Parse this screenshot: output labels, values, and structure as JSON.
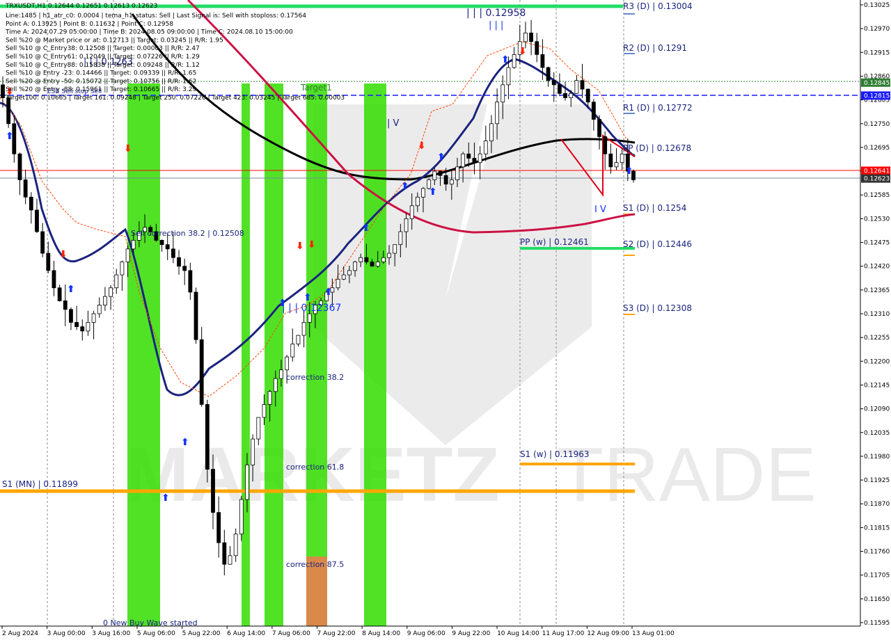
{
  "chart_data": {
    "type": "candlestick",
    "symbol_line": "TRXUSDT,H1  0.12644 0.12651 0.12613 0.12623",
    "info_lines": [
      "Line:1485 | h1_atr_c0: 0.0004 | tema_h1_status: Sell | Last Signal is: Sell with stoploss: 0.17564",
      "Point A: 0.13925 | Point B: 0.11632 | Point C: 0.12958",
      "Time A: 2024.07.29 05:00:00 | Time B: 2024.08.05 09:00:00 | Time C: 2024.08.10 15:00:00",
      "Sell %20 @ Market price or at: 0.12713 || Target: 0.03245 || R/R: 1.95",
      "Sell %10 @ C_Entry38: 0.12508 || Target: 0.00003 || R/R: 2.47",
      "Sell %10 @ C_Entry61: 0.12049 || Target: 0.07226 || R/R: 1.29",
      "Sell %10 @ C_Entry88: 0.15838 || Target: 0.09248 || R/R: 1.12",
      "Sell %10 @ Entry -23: 0.14466 || Target: 0.09339 || R/R: 1.65",
      "Sell %20 @ Entry -50: 0.15072 || Target: 0.10756 || R/R: 1.62",
      "Sell %20 @ Entry -88: 0.15961 || Target: 0.10665 || R/R: 3.29",
      "Target100: 0.10665 | Target 161: 0.09248 | Target 250: 0.07226 | Target 423: 0.03245 | Target 685: 0.00003"
    ],
    "overlap_text": "ESB Sell stop Sell",
    "price_axis": {
      "min": 0.11595,
      "max": 0.13025,
      "ticks": [
        "0.13025",
        "0.12970",
        "0.12915",
        "0.12860",
        "0.12805",
        "0.12750",
        "0.12695",
        "0.12640",
        "0.12585",
        "0.12530",
        "0.12475",
        "0.12420",
        "0.12365",
        "0.12310",
        "0.12255",
        "0.12200",
        "0.12145",
        "0.12090",
        "0.12035",
        "0.11980",
        "0.11925",
        "0.11870",
        "0.11815",
        "0.11760",
        "0.11705",
        "0.11650",
        "0.11595"
      ]
    },
    "time_axis": [
      "2 Aug 2024",
      "3 Aug 00:00",
      "3 Aug 16:00",
      "5 Aug 06:00",
      "5 Aug 22:00",
      "6 Aug 14:00",
      "7 Aug 06:00",
      "7 Aug 22:00",
      "8 Aug 14:00",
      "9 Aug 06:00",
      "9 Aug 22:00",
      "10 Aug 14:00",
      "11 Aug 17:00",
      "12 Aug 09:00",
      "13 Aug 01:00"
    ],
    "price_badges": [
      {
        "text": "0.12845",
        "value": 0.12845,
        "color": "#2e7d32"
      },
      {
        "text": "0.12815",
        "value": 0.12815,
        "color": "#1a1aff"
      },
      {
        "text": "0.12641",
        "value": 0.12641,
        "color": "#ff0000"
      },
      {
        "text": "0.12623",
        "value": 0.12623,
        "color": "#333333"
      }
    ],
    "levels": [
      {
        "text": "R3 (D) | 0.13004",
        "value": 0.13004
      },
      {
        "text": "R2 (D) | 0.1291",
        "value": 0.1291
      },
      {
        "text": "R1 (D) | 0.12772",
        "value": 0.12772
      },
      {
        "text": "PP (D) | 0.12678",
        "value": 0.12678
      },
      {
        "text": "S1 (D) | 0.1254",
        "value": 0.1254
      },
      {
        "text": "S2 (D) | 0.12446",
        "value": 0.12446
      },
      {
        "text": "S3 (D) | 0.12308",
        "value": 0.12308
      },
      {
        "text": "PP (w) | 0.12461",
        "value": 0.12461
      },
      {
        "text": "S1 (w) | 0.11963",
        "value": 0.11963
      },
      {
        "text": "S1 (MN) | 0.11899",
        "value": 0.11899
      }
    ],
    "annotations": {
      "point_c": "| | | 0.12958",
      "point_b_top": "| V",
      "point_b_low": "I V",
      "pivot_mid": "| | | 0.12367",
      "left_mid": "| | | 0.1263",
      "target1": "Target1",
      "sell_correction": "Sell correction 38.2 | 0.12508",
      "correction_382": "correction 38.2",
      "correction_618": "correction 61.8",
      "correction_875": "correction 87.5",
      "new_buy_wave": "0 New Buy Wave started"
    },
    "series": [
      {
        "name": "Close",
        "values": [
          0.1281,
          0.1275,
          0.1268,
          0.1262,
          0.1258,
          0.1255,
          0.125,
          0.1245,
          0.1241,
          0.1237,
          0.1234,
          0.1232,
          0.1229,
          0.1228,
          0.1227,
          0.1229,
          0.1231,
          0.1233,
          0.1235,
          0.1237,
          0.124,
          0.1243,
          0.1246,
          0.1248,
          0.125,
          0.1251,
          0.125,
          0.1248,
          0.1247,
          0.1246,
          0.1244,
          0.1242,
          0.1241,
          0.1236,
          0.1225,
          0.121,
          0.1195,
          0.1185,
          0.1178,
          0.1173,
          0.1175,
          0.118,
          0.1188,
          0.1196,
          0.1202,
          0.1207,
          0.121,
          0.1213,
          0.1216,
          0.1218,
          0.1221,
          0.1224,
          0.1226,
          0.1229,
          0.1231,
          0.1233,
          0.1234,
          0.1236,
          0.1237,
          0.1239,
          0.124,
          0.1241,
          0.1243,
          0.1244,
          0.1243,
          0.1242,
          0.1243,
          0.1244,
          0.1245,
          0.1247,
          0.125,
          0.1253,
          0.1256,
          0.1258,
          0.126,
          0.1262,
          0.1264,
          0.1263,
          0.1261,
          0.1262,
          0.1265,
          0.1268,
          0.1267,
          0.1266,
          0.1268,
          0.1271,
          0.1275,
          0.128,
          0.1284,
          0.1288,
          0.1291,
          0.1294,
          0.1296,
          0.1294,
          0.1291,
          0.1288,
          0.1285,
          0.1284,
          0.1282,
          0.1281,
          0.1282,
          0.1285,
          0.1283,
          0.128,
          0.1276,
          0.1272,
          0.1268,
          0.1265,
          0.1266,
          0.1268,
          0.1264,
          0.1262
        ]
      }
    ]
  }
}
